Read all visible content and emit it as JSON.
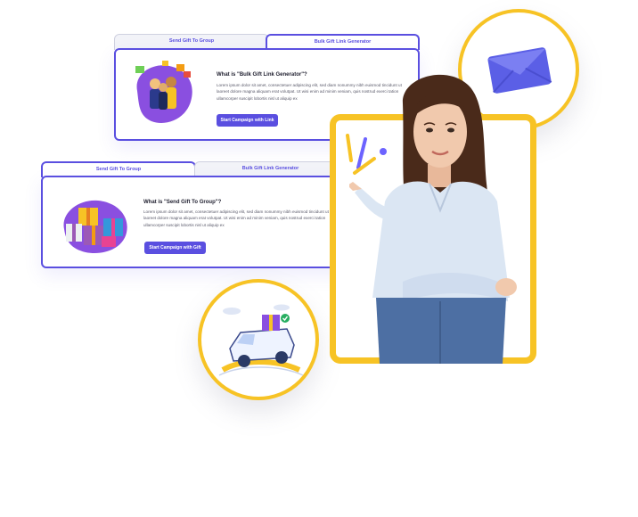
{
  "card_top": {
    "tabs": [
      "Send Gift To Group",
      "Bulk Gift Link Generator"
    ],
    "question": "What is \"Bulk Gift Link Generator\"?",
    "description": "Lorem ipsum dolor sit amet, consectetuer adipiscing elit, sed diam nonummy nibh euismod tincidunt ut laoreet dolore magna aliquam erat volutpat. Ut wisi enim ad minim veniam, quis nostrud exerci tation ullamcorper suscipit lobortis nisl ut aliquip ex",
    "button": "Start Campaign with Link"
  },
  "card_bottom": {
    "tabs": [
      "Send Gift To Group",
      "Bulk Gift Link Generator"
    ],
    "question": "What is \"Send Gift To Group\"?",
    "description": "Lorem ipsum dolor sit amet, consectetuer adipiscing elit, sed diam nonummy nibh euismod tincidunt ut laoreet dolore magna aliquam erat volutpat. Ut wisi enim ad minim veniam, quis nostrud exerci tation ullamcorper suscipit lobortis nisl ut aliquip ex",
    "button": "Start Campaign with Gift"
  },
  "icons": [
    "envelope-icon",
    "delivery-van-icon",
    "gift-boxes-icon",
    "people-celebrating-icon"
  ],
  "colors": {
    "accent": "#5a4fe0",
    "frame": "#f7c325",
    "tab_bg": "#f2f3f8"
  }
}
